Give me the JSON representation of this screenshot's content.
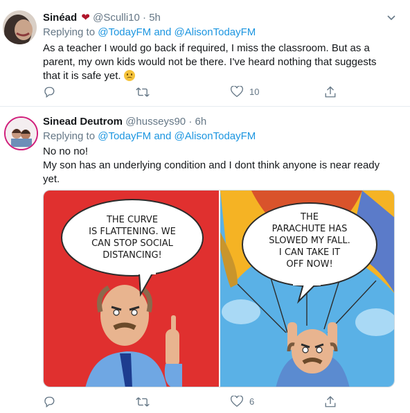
{
  "tweets": [
    {
      "name": "Sinéad",
      "handle": "@Sculli10",
      "separator": "·",
      "time": "5h",
      "replying_prefix": "Replying to",
      "reply_to_1": "@TodayFM",
      "reply_and": "and",
      "reply_to_2": "@AlisonTodayFM",
      "text": "As a teacher I would go back if required, I miss the classroom. But as a parent, my own kids would not be there. I've heard nothing that suggests that it is safe yet.",
      "likes": "10"
    },
    {
      "name": "Sinead Deutrom",
      "handle": "@husseys90",
      "separator": "·",
      "time": "6h",
      "replying_prefix": "Replying to",
      "reply_to_1": "@TodayFM",
      "reply_and": "and",
      "reply_to_2": "@AlisonTodayFM",
      "text_line1": "No no no!",
      "text_line2": "My son has an underlying condition and I dont think anyone is near ready yet.",
      "likes": "6"
    }
  ],
  "cartoon": {
    "left_bubble": [
      "THE CURVE",
      "IS FLATTENING. WE",
      "CAN STOP SOCIAL",
      "DISTANCING!"
    ],
    "right_bubble": [
      "THE",
      "PARACHUTE HAS",
      "SLOWED MY FALL.",
      "I CAN TAKE IT",
      "OFF NOW!"
    ]
  },
  "icons": [
    "chevron-down-icon",
    "reply-icon",
    "retweet-icon",
    "like-icon",
    "share-icon",
    "heart-emoji-icon",
    "frown-emoji-icon"
  ],
  "colors": {
    "link": "#1b95e0",
    "muted": "#657786",
    "heart": "#b0152b",
    "divider": "#e6ecf0"
  }
}
